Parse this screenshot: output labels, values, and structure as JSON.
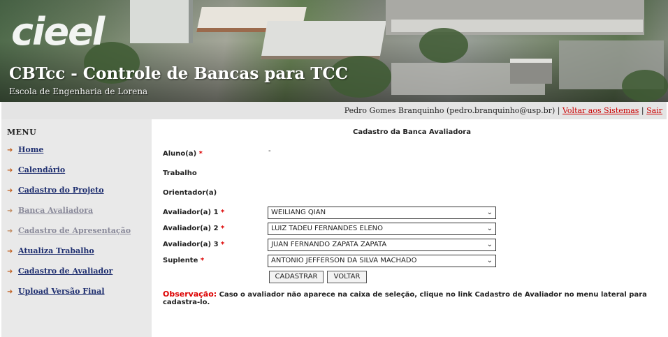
{
  "header": {
    "logo_text": "cieel",
    "title": "CBTcc - Controle de Bancas para TCC",
    "subtitle": "Escola de Engenharia de Lorena"
  },
  "userbar": {
    "user": "Pedro Gomes Branquinho (pedro.branquinho@usp.br)",
    "separator": "|",
    "back_link": "Voltar aos Sistemas",
    "logout_link": "Sair"
  },
  "sidebar": {
    "title": "MENU",
    "items": [
      {
        "label": "Home",
        "enabled": true
      },
      {
        "label": "Calendário",
        "enabled": true
      },
      {
        "label": "Cadastro do Projeto",
        "enabled": true
      },
      {
        "label": "Banca Avaliadora",
        "enabled": false
      },
      {
        "label": "Cadastro de Apresentação",
        "enabled": false
      },
      {
        "label": "Atualiza Trabalho",
        "enabled": true
      },
      {
        "label": "Cadastro de Avaliador",
        "enabled": true
      },
      {
        "label": "Upload Versão Final",
        "enabled": true
      }
    ]
  },
  "form": {
    "title": "Cadastro da Banca Avaliadora",
    "aluno_label": "Aluno(a)",
    "aluno_value": "-",
    "trabalho_label": "Trabalho",
    "orientador_label": "Orientador(a)",
    "avaliador1_label": "Avaliador(a) 1",
    "avaliador1_value": "WEILIANG QIAN",
    "avaliador2_label": "Avaliador(a) 2",
    "avaliador2_value": "LUIZ TADEU FERNANDES ELENO",
    "avaliador3_label": "Avaliador(a) 3",
    "avaliador3_value": "JUAN FERNANDO ZAPATA ZAPATA",
    "suplente_label": "Suplente",
    "suplente_value": "ANTONIO JEFFERSON DA SILVA MACHADO",
    "required_mark": "*",
    "submit_label": "CADASTRAR",
    "back_label": "VOLTAR"
  },
  "observation": {
    "label": "Observação:",
    "text": "Caso o avaliador não aparece na caixa de seleção, clique no link Cadastro de Avaliador no menu lateral para cadastra-lo."
  },
  "colors": {
    "link": "#1f2f70",
    "alert": "#dd0000",
    "sidebar_bg": "#e9e9e9",
    "userbar_bg": "#e4e4e4"
  }
}
